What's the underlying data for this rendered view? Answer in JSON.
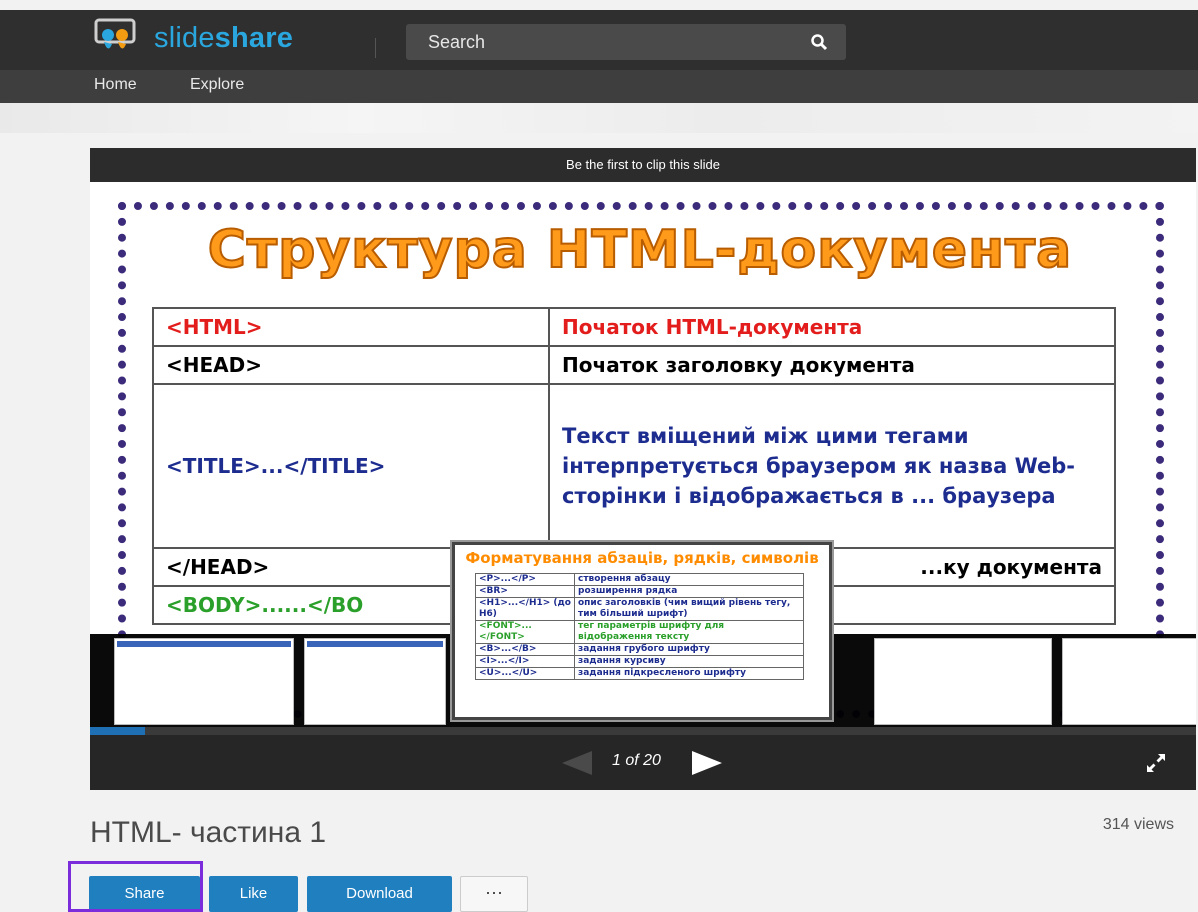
{
  "header": {
    "logo_text_light": "slide",
    "logo_text_bold": "share",
    "search_placeholder": "Search"
  },
  "nav": {
    "items": [
      {
        "label": "Home"
      },
      {
        "label": "Explore"
      }
    ]
  },
  "player": {
    "clip_text": "Be the first to clip this slide",
    "slide": {
      "title": "Структура HTML-документа",
      "rows": [
        {
          "tag": "<HTML>",
          "desc": "Початок HTML-документа"
        },
        {
          "tag": "<HEAD>",
          "desc": "Початок заголовку документа"
        },
        {
          "tag": "<TITLE>...</TITLE>",
          "desc": "Текст вміщений між цими тегами інтерпретується браузером як назва Web-сторінки і відображається в ... браузера"
        },
        {
          "tag": "</HEAD>",
          "desc": "...ку документа"
        },
        {
          "tag": "<BODY>......</BO",
          "desc": ""
        }
      ]
    },
    "popup": {
      "title": "Форматування абзаців, рядків, символів",
      "rows": [
        {
          "tag": "<P>...</P>",
          "desc": "створення абзацу"
        },
        {
          "tag": "<BR>",
          "desc": "розширення рядка"
        },
        {
          "tag": "<H1>...</H1> (до H6)",
          "desc": "опис заголовків (чим вищий рівень тегу, тим більший шрифт)"
        },
        {
          "tag": "<FONT>... </FONT>",
          "desc": "тег параметрів шрифту для відображення тексту"
        },
        {
          "tag": "<B>...</B>",
          "desc": "задання грубого шрифту"
        },
        {
          "tag": "<I>...</I>",
          "desc": "задання курсиву"
        },
        {
          "tag": "<U>...</U>",
          "desc": "задання підкресленого шрифту"
        }
      ]
    },
    "page_indicator": "1 of 20",
    "progress_fraction": 0.05
  },
  "document": {
    "title": "HTML- частина 1",
    "views": "314 views"
  },
  "actions": {
    "share_label": "Share",
    "like_label": "Like",
    "download_label": "Download",
    "more_label": "···"
  },
  "colors": {
    "brand": "#2aa7df",
    "button": "#1f7fbf",
    "highlight": "#7b2ddc"
  }
}
